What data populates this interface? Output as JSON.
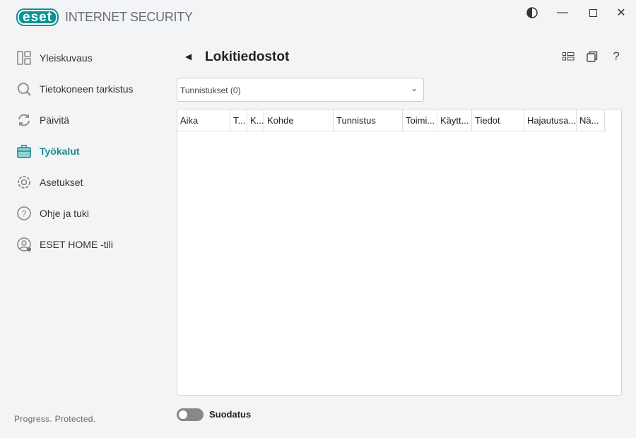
{
  "app": {
    "logo": "eset",
    "product": "INTERNET SECURITY",
    "tagline": "Progress. Protected."
  },
  "sidebar": {
    "items": [
      {
        "label": "Yleiskuvaus",
        "icon": "dashboard-icon"
      },
      {
        "label": "Tietokoneen tarkistus",
        "icon": "search-icon"
      },
      {
        "label": "Päivitä",
        "icon": "refresh-icon"
      },
      {
        "label": "Työkalut",
        "icon": "toolbox-icon",
        "active": true
      },
      {
        "label": "Asetukset",
        "icon": "gear-icon"
      },
      {
        "label": "Ohje ja tuki",
        "icon": "help-icon"
      },
      {
        "label": "ESET HOME -tili",
        "icon": "account-icon"
      }
    ]
  },
  "main": {
    "title": "Lokitiedostot",
    "log_select": {
      "value": "Tunnistukset (0)"
    },
    "table": {
      "columns": [
        "Aika",
        "T...",
        "K...",
        "Kohde",
        "Tunnistus",
        "Toimi...",
        "Käytt...",
        "Tiedot",
        "Hajautusa...",
        "Nä..."
      ],
      "rows": []
    },
    "filter": {
      "label": "Suodatus",
      "enabled": false
    }
  },
  "colors": {
    "accent": "#1b8a8f",
    "brand": "#0a9396"
  }
}
